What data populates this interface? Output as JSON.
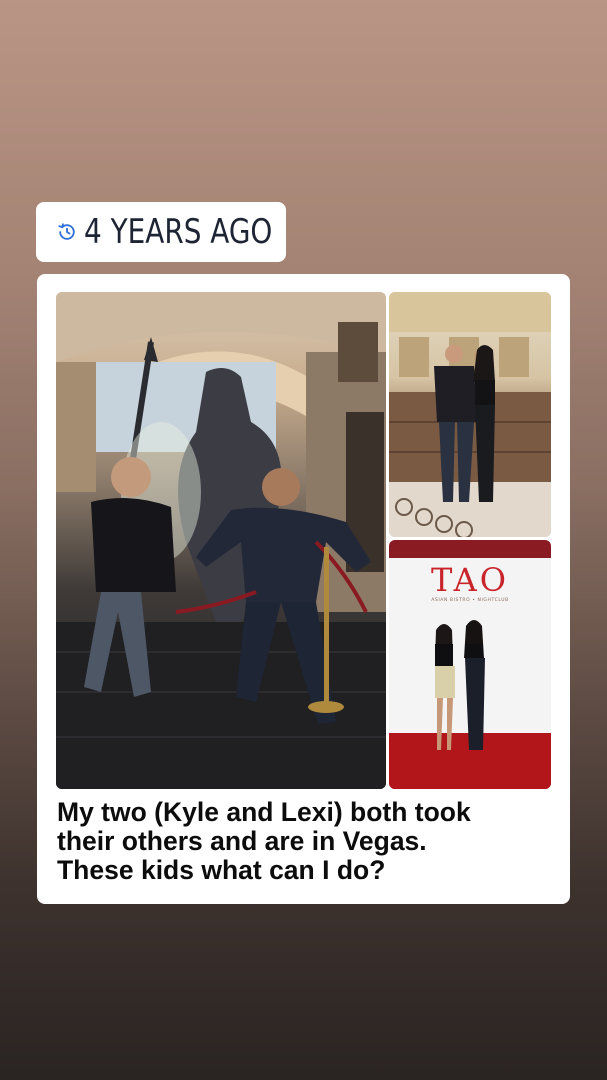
{
  "memory_badge": {
    "icon": "history-clock-icon",
    "text": "4 YEARS AGO",
    "icon_color": "#2f6fd8",
    "text_color": "#1d2433"
  },
  "post": {
    "photos": [
      {
        "name": "photo-main",
        "description_icon": "image"
      },
      {
        "name": "photo-top-right",
        "description_icon": "image"
      },
      {
        "name": "photo-bottom-right",
        "sign_text": "TAO",
        "sign_subtext": "ASIAN BISTRO • NIGHTCLUB"
      }
    ],
    "caption_lines": [
      "My two (Kyle and Lexi) both took",
      "their others and are in Vegas.",
      "These kids what can I do?"
    ]
  },
  "colors": {
    "card_bg": "#ffffff",
    "sign_red": "#c8242a",
    "carpet_red": "#b3161a"
  }
}
